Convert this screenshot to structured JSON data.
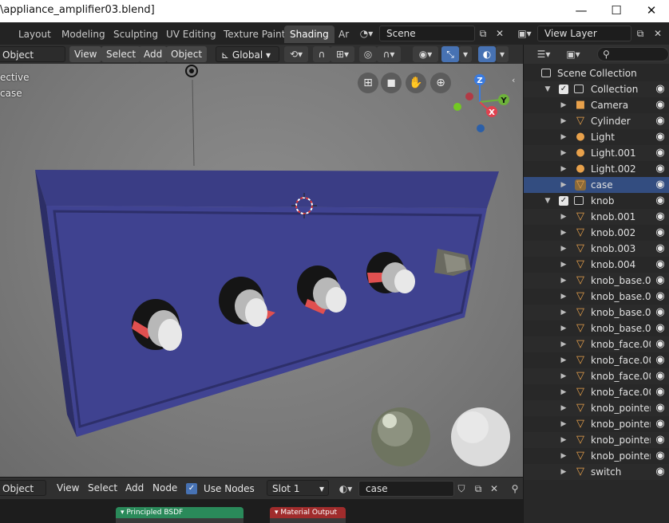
{
  "window": {
    "title": "\\appliance_amplifier03.blend]",
    "minimize": "—",
    "maximize": "☐",
    "close": "✕"
  },
  "workspaces": {
    "tabs": [
      "Layout",
      "Modeling",
      "Sculpting",
      "UV Editing",
      "Texture Paint",
      "Shading",
      "Ar"
    ],
    "active": "Shading"
  },
  "scene": {
    "name": "Scene"
  },
  "view_layer": {
    "name": "View Layer"
  },
  "viewport_header": {
    "mode": "Object Mode",
    "menus": [
      "View",
      "Select",
      "Add",
      "Object"
    ],
    "orientation": "Global"
  },
  "viewport": {
    "overlay_line1": "ective",
    "overlay_line2": "case",
    "gizmo": {
      "z": "Z",
      "y": "Y",
      "x": "X"
    }
  },
  "outliner": {
    "root": "Scene Collection",
    "items": [
      {
        "name": "Collection",
        "kind": "collection",
        "level": 1
      },
      {
        "name": "Camera",
        "kind": "camera",
        "level": 2
      },
      {
        "name": "Cylinder",
        "kind": "mesh",
        "level": 2
      },
      {
        "name": "Light",
        "kind": "light",
        "level": 2
      },
      {
        "name": "Light.001",
        "kind": "light",
        "level": 2
      },
      {
        "name": "Light.002",
        "kind": "light",
        "level": 2
      },
      {
        "name": "case",
        "kind": "mesh",
        "level": 2,
        "selected": true
      },
      {
        "name": "knob",
        "kind": "collection",
        "level": 1
      },
      {
        "name": "knob.001",
        "kind": "mesh",
        "level": 2
      },
      {
        "name": "knob.002",
        "kind": "mesh",
        "level": 2
      },
      {
        "name": "knob.003",
        "kind": "mesh",
        "level": 2
      },
      {
        "name": "knob.004",
        "kind": "mesh",
        "level": 2
      },
      {
        "name": "knob_base.001",
        "kind": "mesh",
        "level": 2
      },
      {
        "name": "knob_base.002",
        "kind": "mesh",
        "level": 2
      },
      {
        "name": "knob_base.003",
        "kind": "mesh",
        "level": 2
      },
      {
        "name": "knob_base.004",
        "kind": "mesh",
        "level": 2
      },
      {
        "name": "knob_face.001",
        "kind": "mesh",
        "level": 2
      },
      {
        "name": "knob_face.002",
        "kind": "mesh",
        "level": 2
      },
      {
        "name": "knob_face.003",
        "kind": "mesh",
        "level": 2
      },
      {
        "name": "knob_face.004",
        "kind": "mesh",
        "level": 2
      },
      {
        "name": "knob_pointer.0",
        "kind": "mesh",
        "level": 2
      },
      {
        "name": "knob_pointer.0",
        "kind": "mesh",
        "level": 2
      },
      {
        "name": "knob_pointer.0",
        "kind": "mesh",
        "level": 2
      },
      {
        "name": "knob_pointer.0",
        "kind": "mesh",
        "level": 2
      },
      {
        "name": "switch",
        "kind": "mesh",
        "level": 2
      }
    ]
  },
  "node_header": {
    "mode": "Object",
    "menus": [
      "View",
      "Select",
      "Add",
      "Node"
    ],
    "use_nodes_label": "Use Nodes",
    "slot": "Slot 1",
    "material": "case"
  },
  "nodes": {
    "principled": "Principled BSDF",
    "output": "Material Output"
  },
  "colors": {
    "accent": "#4772b3",
    "case_body": "#3d3f8f",
    "selected_row": "#334d80",
    "mesh_icon": "#e8a14b"
  }
}
